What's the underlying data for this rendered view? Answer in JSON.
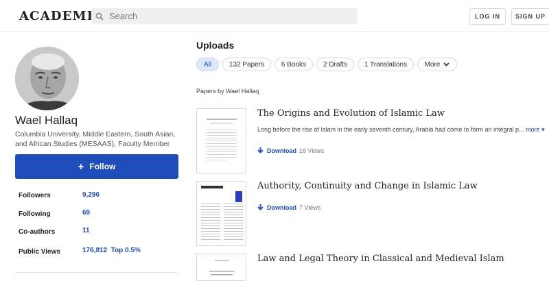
{
  "header": {
    "logo": "ACADEMIA",
    "search_placeholder": "Search",
    "login_label": "LOG IN",
    "signup_label": "SIGN UP"
  },
  "profile": {
    "name": "Wael Hallaq",
    "affiliation": "Columbia University, Middle Eastern, South Asian, and African Studies (MESAAS), Faculty Member",
    "follow_label": "Follow",
    "stats": [
      {
        "label": "Followers",
        "value": "9,296"
      },
      {
        "label": "Following",
        "value": "69"
      },
      {
        "label": "Co-authors",
        "value": "11"
      },
      {
        "label": "Public Views",
        "value": "176,812  Top 0.5%"
      }
    ]
  },
  "uploads": {
    "heading": "Uploads",
    "tabs": [
      "All",
      "132 Papers",
      "6 Books",
      "2 Drafts",
      "1 Translations",
      "More"
    ],
    "active_tab": "All",
    "papers_by": "Papers by Wael Hallaq"
  },
  "papers": [
    {
      "title": "The Origins and Evolution of Islamic Law",
      "abstract": "Long before the rise of Islam in the early seventh century, Arabia had come to form an integral p...",
      "more_label": "more",
      "download_label": "Download",
      "views": "16 Views"
    },
    {
      "title": "Authority, Continuity and Change in Islamic Law",
      "download_label": "Download",
      "views": "7 Views"
    },
    {
      "title": "Law and Legal Theory in Classical and Medieval Islam"
    }
  ],
  "colors": {
    "accent": "#1f4dbc",
    "active_tab_bg": "#dfe7fb"
  }
}
